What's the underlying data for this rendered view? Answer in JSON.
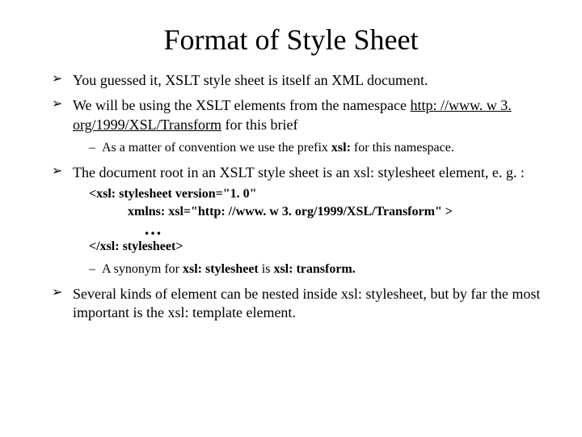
{
  "title": "Format of Style Sheet",
  "items": {
    "i0": {
      "pre": "You guessed it, XSLT style sheet is itself an XML document."
    },
    "i1": {
      "pre": "We will be using the XSLT elements from the namespace ",
      "link": "http: //www. w 3. org/1999/XSL/Transform",
      "post": " for this brief",
      "sub0a": "As a matter of convention we use the prefix ",
      "sub0bold": "xsl:",
      "sub0b": " for this namespace."
    },
    "i2": {
      "pre": "The document root in an XSLT style sheet is an xsl: stylesheet element, e. g. :",
      "code_l1": "<xsl: stylesheet version=\"1. 0\"",
      "code_l2": "            xmlns: xsl=\"http: //www. w 3. org/1999/XSL/Transform\" >",
      "code_ell": "…",
      "code_l3": "</xsl: stylesheet>",
      "sub0a": "A synonym for ",
      "sub0b1": "xsl: stylesheet",
      "sub0mid": " is ",
      "sub0b2": "xsl: transform."
    },
    "i3": {
      "pre": "Several kinds of element can be nested inside xsl: stylesheet, but by far the most important is the xsl: template element."
    }
  }
}
